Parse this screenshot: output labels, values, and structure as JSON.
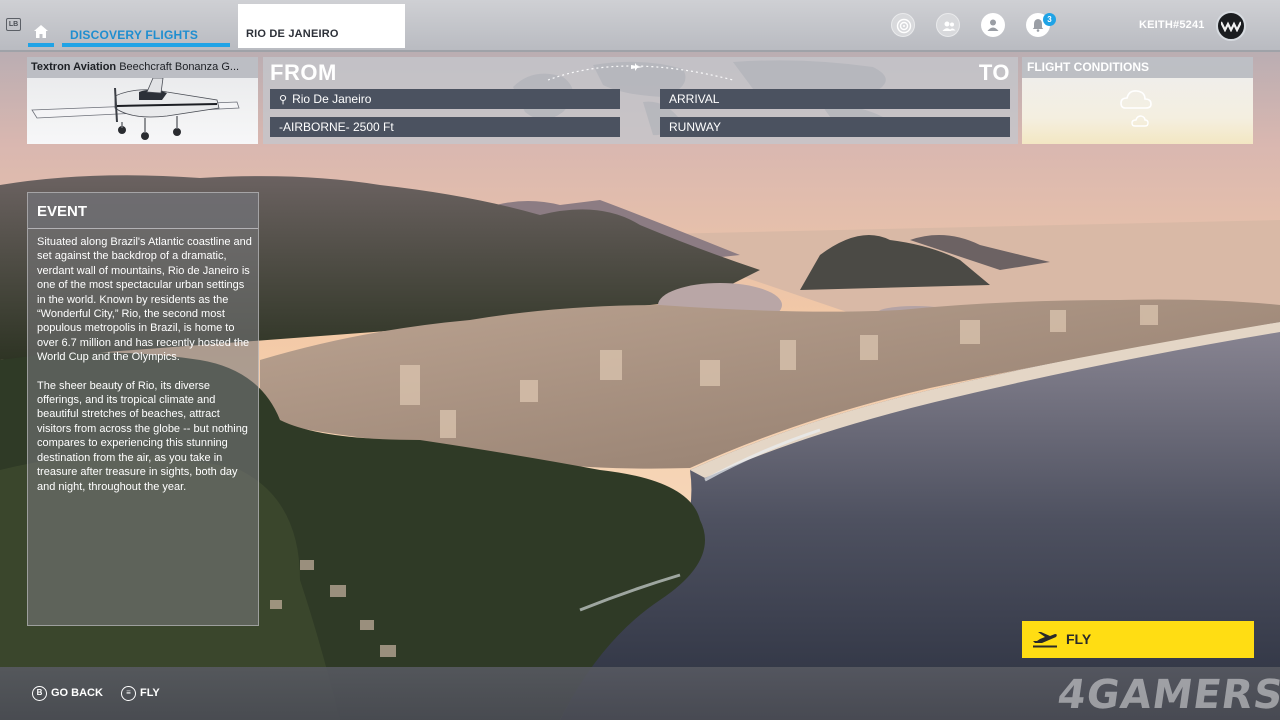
{
  "topbar": {
    "lb_hint": "LB",
    "tabs": [
      {
        "label": "DISCOVERY FLIGHTS"
      },
      {
        "label": "RIO DE JANEIRO"
      }
    ],
    "notification_count": "3",
    "username": "KEITH#5241",
    "accent_color": "#1fa3e6"
  },
  "aircraft": {
    "manufacturer": "Textron Aviation",
    "model": "Beechcraft Bonanza G..."
  },
  "route": {
    "from_label": "FROM",
    "to_label": "TO",
    "departure": "Rio De Janeiro",
    "departure_state": "-AIRBORNE- 2500 Ft",
    "arrival": "ARRIVAL",
    "arrival_state": "RUNWAY"
  },
  "flight_conditions": {
    "title": "FLIGHT CONDITIONS",
    "icon": "cloud-icon"
  },
  "event": {
    "title": "EVENT",
    "paragraphs": [
      "Situated along Brazil's Atlantic coastline and set against the backdrop of a dramatic, verdant wall of mountains, Rio de Janeiro is one of the most spectacular urban settings in the world. Known by residents as the “Wonderful City,” Rio, the second most populous metropolis in Brazil, is home to over 6.7 million and has recently hosted the World Cup and the Olympics.",
      "The sheer beauty of Rio, its diverse offerings, and its tropical climate and beautiful stretches of beaches, attract visitors from across the globe -- but nothing compares to experiencing this stunning destination from the air, as you take in treasure after treasure in sights, both day and night, throughout the year."
    ]
  },
  "fly_button": {
    "label": "FLY",
    "color": "#ffdd13"
  },
  "bottombar": {
    "hints": [
      {
        "glyph": "B",
        "label": "GO BACK"
      },
      {
        "glyph": "≡",
        "label": "FLY"
      }
    ]
  },
  "watermark": "4GAMERS"
}
